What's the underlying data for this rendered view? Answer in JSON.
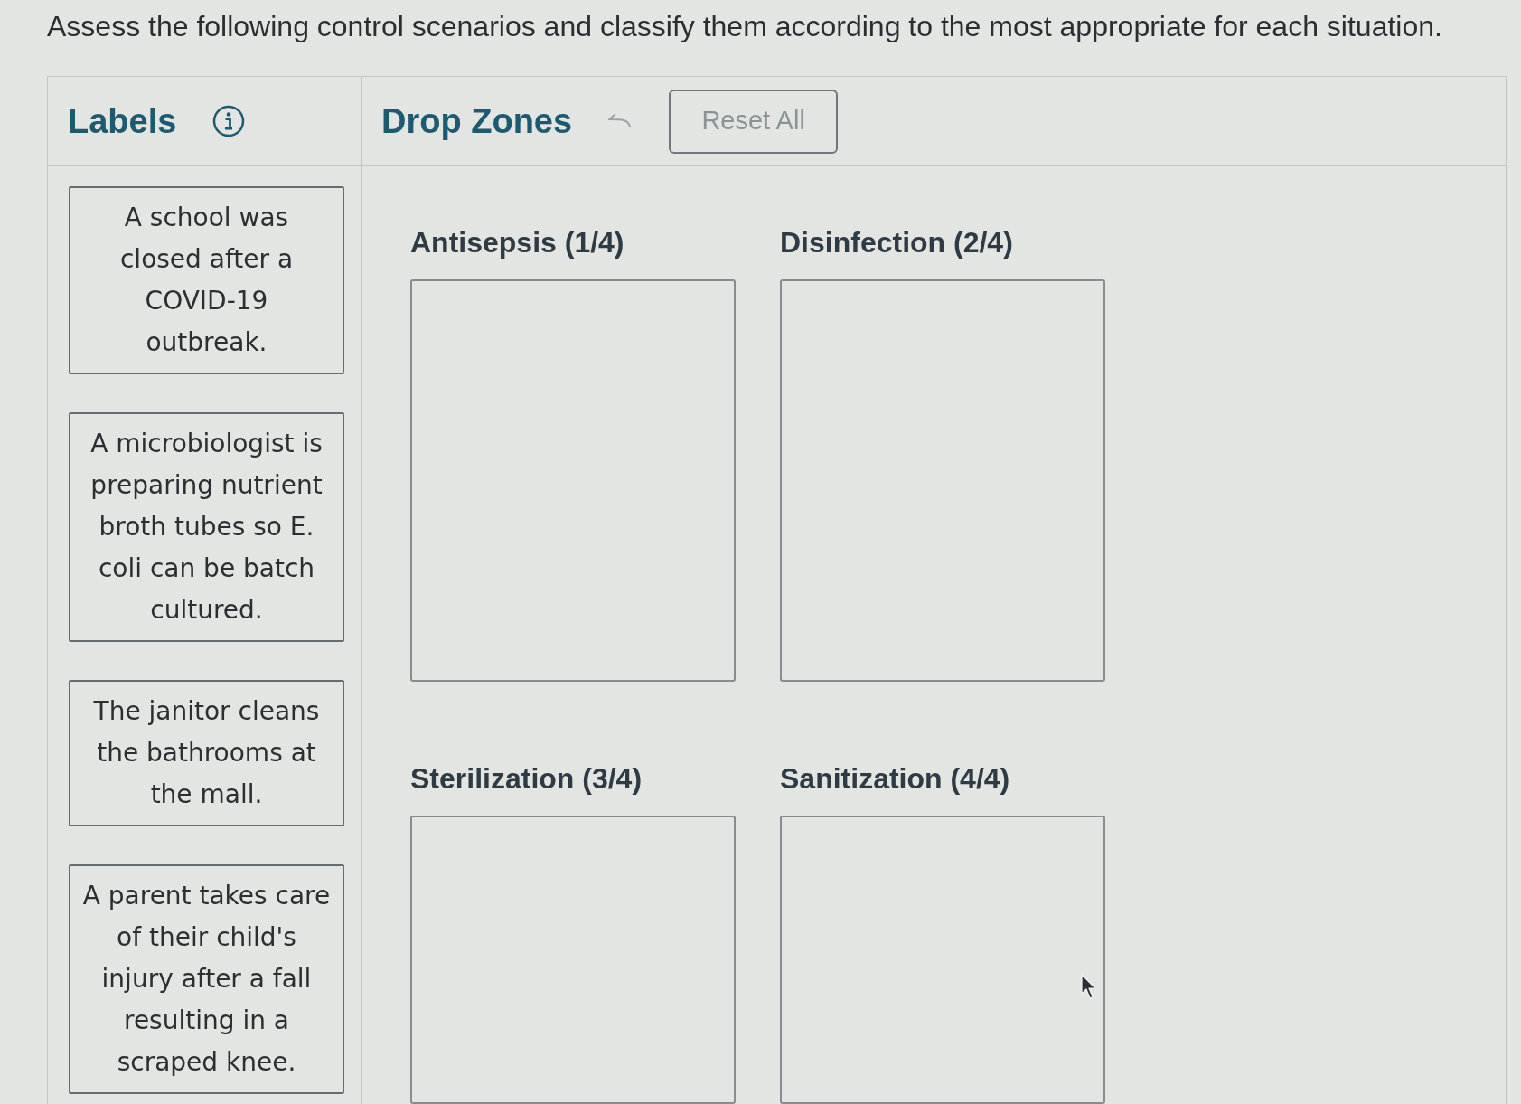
{
  "instructions": "Assess the following control scenarios and classify them according to the most appropriate for each situation.",
  "labels": {
    "title": "Labels",
    "cards": [
      {
        "text": "A school was closed after a COVID-19 outbreak."
      },
      {
        "text": "A microbiologist is preparing nutrient broth tubes so E. coli can be batch cultured."
      },
      {
        "text": "The janitor cleans the bathrooms at the mall."
      },
      {
        "text": "A parent takes care of their child's injury after a fall resulting in a scraped knee."
      }
    ]
  },
  "drop_zones": {
    "title": "Drop Zones",
    "undo": {
      "disabled": true
    },
    "reset_button": {
      "label": "Reset All"
    },
    "zones": [
      {
        "title": "Antisepsis (1/4)"
      },
      {
        "title": "Disinfection (2/4)"
      },
      {
        "title": "Sterilization (3/4)"
      },
      {
        "title": "Sanitization (4/4)"
      }
    ]
  }
}
